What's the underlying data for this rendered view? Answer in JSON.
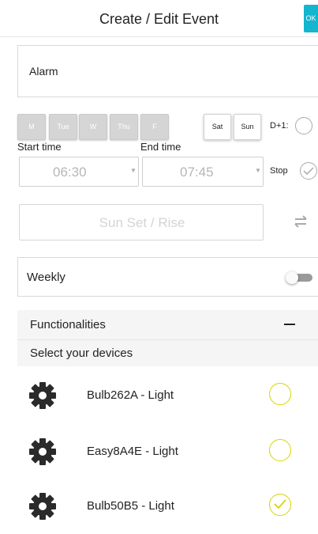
{
  "header": {
    "title": "Create / Edit Event",
    "ok_label": "OK"
  },
  "event": {
    "name": "Alarm"
  },
  "days": [
    {
      "label": "M",
      "selected": false
    },
    {
      "label": "Tue",
      "selected": false
    },
    {
      "label": "W",
      "selected": false
    },
    {
      "label": "Thu",
      "selected": false
    },
    {
      "label": "F",
      "selected": false
    },
    {
      "label": "Sat",
      "selected": true
    },
    {
      "label": "Sun",
      "selected": true
    }
  ],
  "d1": {
    "label": "D+1:",
    "checked": false
  },
  "time": {
    "start_label": "Start time",
    "end_label": "End time",
    "start_value": "06:30",
    "end_value": "07:45",
    "caret": "▼"
  },
  "stop": {
    "label": "Stop",
    "checked": true
  },
  "sun": {
    "label": "Sun Set / Rise"
  },
  "weekly": {
    "label": "Weekly",
    "enabled": false
  },
  "functionalities": {
    "title": "Functionalities",
    "select_label": "Select your devices",
    "devices": [
      {
        "name": "Bulb262A - Light",
        "selected": false
      },
      {
        "name": "Easy8A4E - Light",
        "selected": false
      },
      {
        "name": "Bulb50B5 - Light",
        "selected": true
      }
    ]
  },
  "colors": {
    "accent": "#13b5cf",
    "check": "#d9d400"
  }
}
